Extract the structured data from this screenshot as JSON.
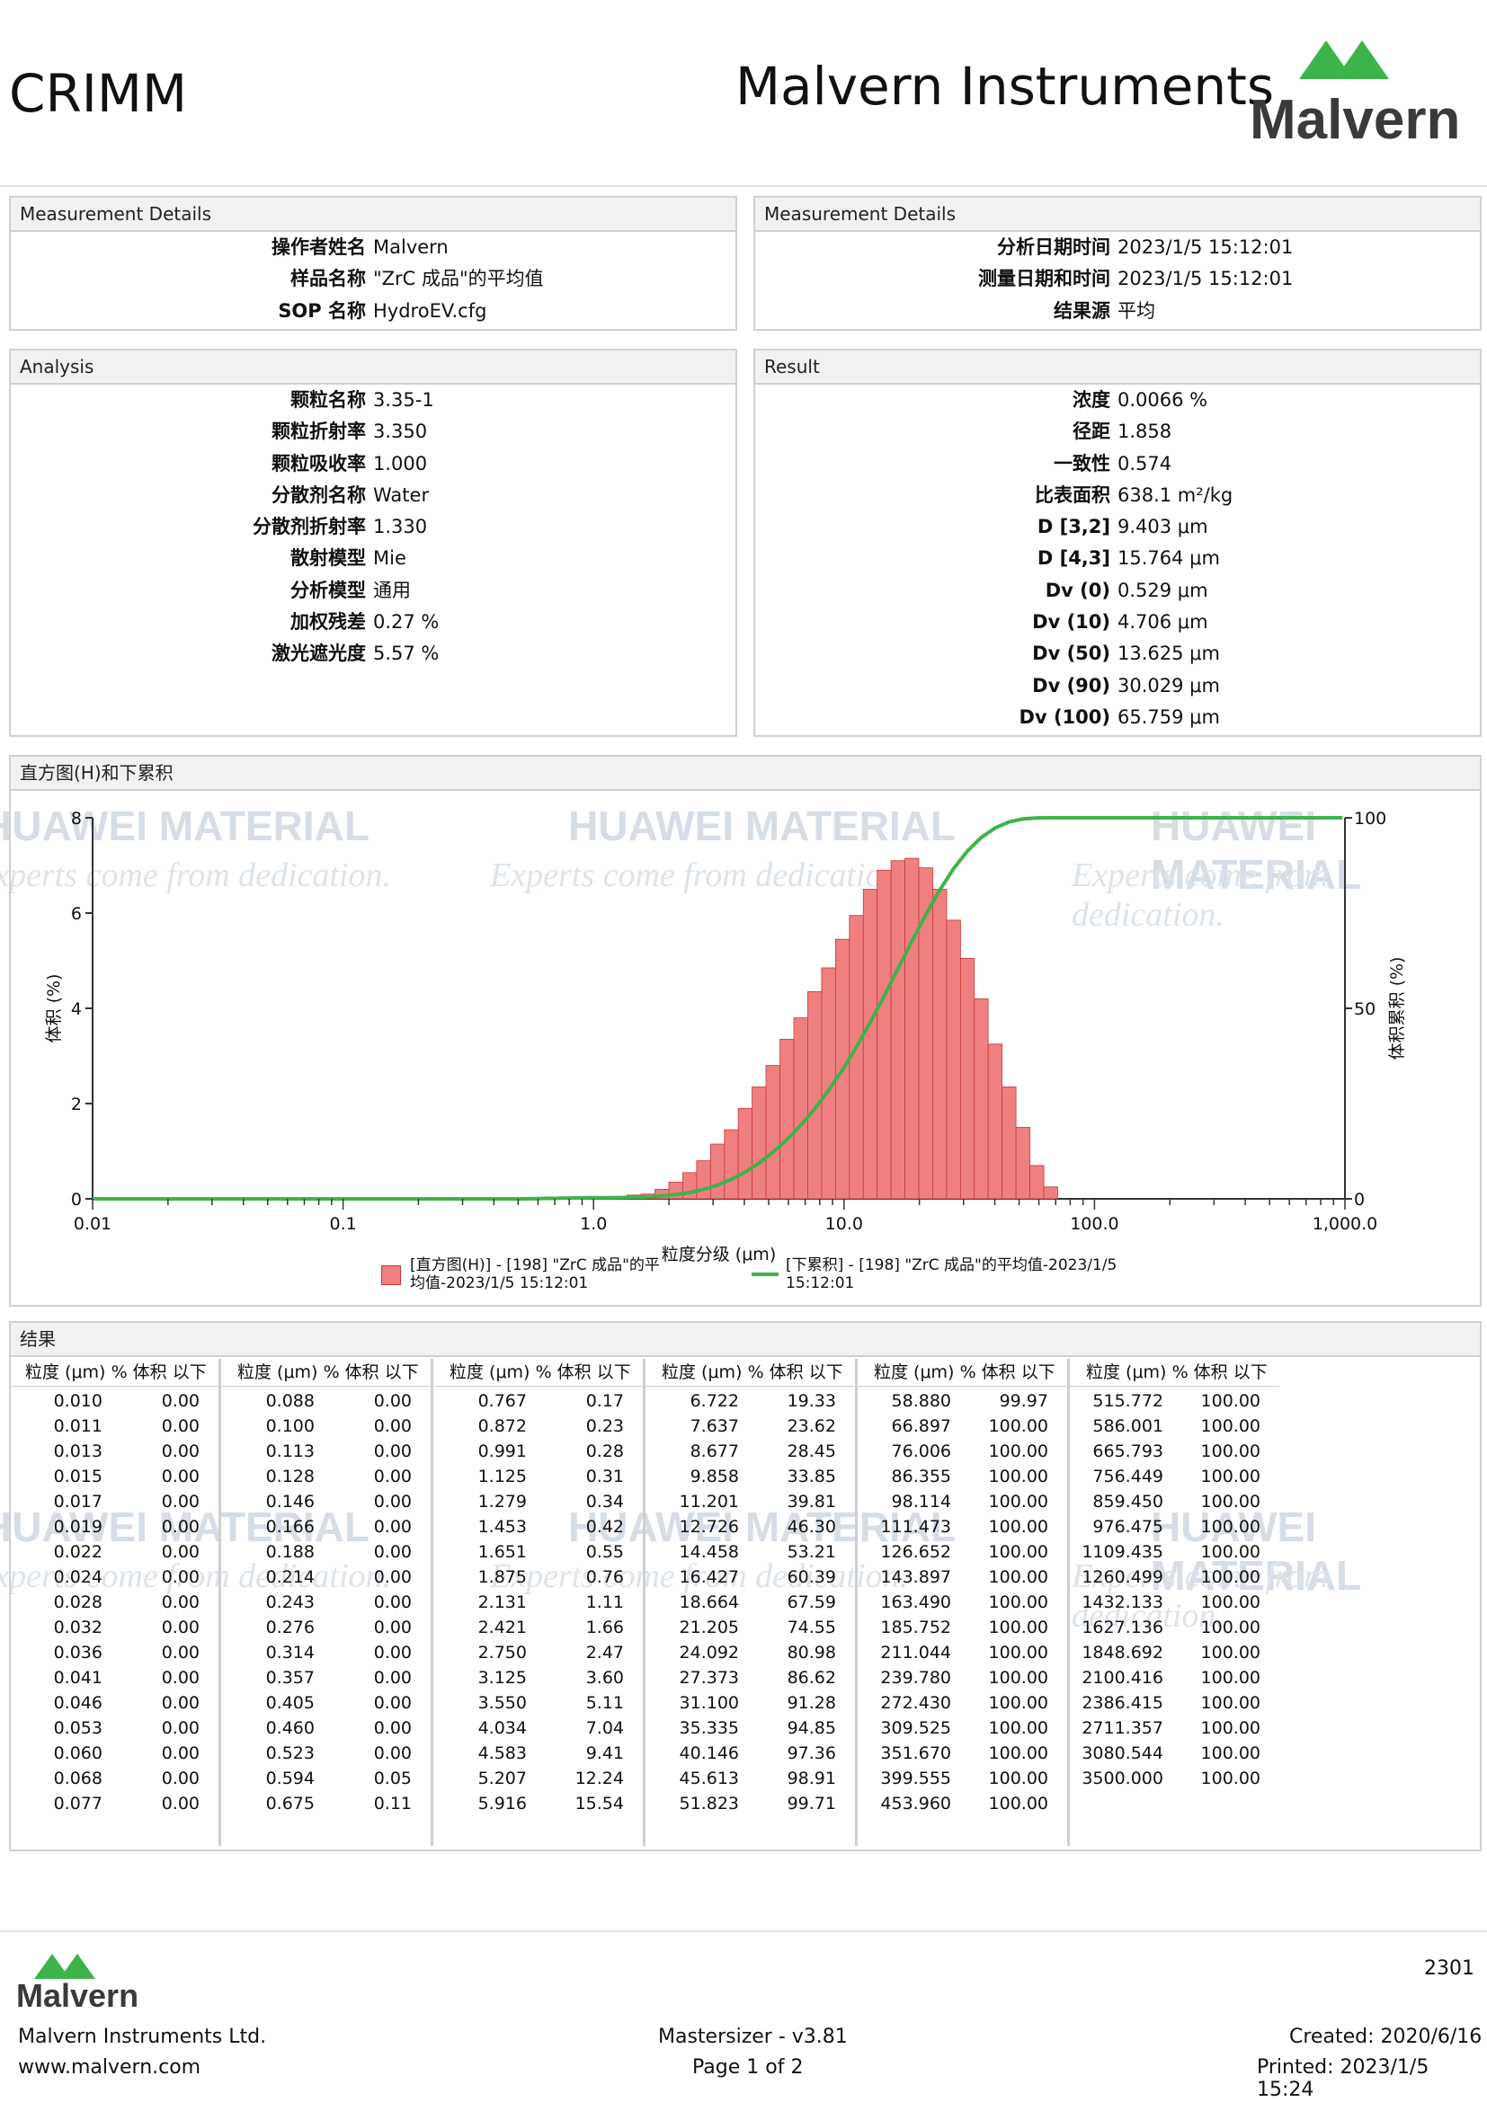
{
  "header": {
    "org": "CRIMM",
    "company": "Malvern Instruments",
    "logo_text": "Malvern"
  },
  "details_left": {
    "title": "Measurement Details",
    "rows": [
      {
        "k": "操作者姓名",
        "v": "Malvern"
      },
      {
        "k": "样品名称",
        "v": "\"ZrC 成品\"的平均值"
      },
      {
        "k": "SOP 名称",
        "v": "HydroEV.cfg"
      }
    ]
  },
  "details_right": {
    "title": "Measurement Details",
    "rows": [
      {
        "k": "分析日期时间",
        "v": "2023/1/5 15:12:01"
      },
      {
        "k": "测量日期和时间",
        "v": "2023/1/5 15:12:01"
      },
      {
        "k": "结果源",
        "v": "平均"
      }
    ]
  },
  "analysis": {
    "title": "Analysis",
    "rows": [
      {
        "k": "颗粒名称",
        "v": "3.35-1"
      },
      {
        "k": "颗粒折射率",
        "v": "3.350"
      },
      {
        "k": "颗粒吸收率",
        "v": "1.000"
      },
      {
        "k": "分散剂名称",
        "v": "Water"
      },
      {
        "k": "分散剂折射率",
        "v": "1.330"
      },
      {
        "k": "散射模型",
        "v": "Mie"
      },
      {
        "k": "分析模型",
        "v": "通用"
      },
      {
        "k": "加权残差",
        "v": "0.27 %"
      },
      {
        "k": "激光遮光度",
        "v": "5.57 %"
      }
    ]
  },
  "result": {
    "title": "Result",
    "rows": [
      {
        "k": "浓度",
        "v": "0.0066 %"
      },
      {
        "k": "径距",
        "v": "1.858"
      },
      {
        "k": "一致性",
        "v": "0.574"
      },
      {
        "k": "比表面积",
        "v": "638.1 m²/kg"
      },
      {
        "k": "D [3,2]",
        "v": "9.403 μm"
      },
      {
        "k": "D [4,3]",
        "v": "15.764 μm"
      },
      {
        "k": "Dv (0)",
        "v": "0.529 μm"
      },
      {
        "k": "Dv (10)",
        "v": "4.706 μm"
      },
      {
        "k": "Dv (50)",
        "v": "13.625 μm"
      },
      {
        "k": "Dv (90)",
        "v": "30.029 μm"
      },
      {
        "k": "Dv (100)",
        "v": "65.759 μm"
      }
    ]
  },
  "watermark": {
    "line1": "HUAWEI MATERIAL",
    "line2": "Experts come from dedication."
  },
  "chart_data": {
    "type": "bar",
    "title": "直方图(H)和下累积",
    "xlabel": "粒度分级 (μm)",
    "ylabel": "体积 (%)",
    "y2label": "体积累积 (%)",
    "xscale": "log",
    "xlim": [
      0.01,
      1000
    ],
    "ylim": [
      0,
      8
    ],
    "y2lim": [
      0,
      100
    ],
    "xticks": [
      "0.01",
      "0.1",
      "1.0",
      "10.0",
      "100.0",
      "1,000.0"
    ],
    "yticks": [
      "0",
      "2",
      "4",
      "6",
      "8"
    ],
    "y2ticks": [
      "0",
      "50",
      "100"
    ],
    "colors": {
      "hist": "#f08080",
      "hist_edge": "#c43a3a",
      "cum": "#3cb44b"
    },
    "series": [
      {
        "name": "[直方图(H)] - [198] \"ZrC 成品\"的平均值-2023/1/5 15:12:01",
        "type": "bar",
        "x": [
          0.525,
          0.6,
          0.68,
          0.77,
          0.87,
          0.99,
          1.125,
          1.28,
          1.45,
          1.65,
          1.875,
          2.13,
          2.42,
          2.75,
          3.125,
          3.55,
          4.03,
          4.58,
          5.2,
          5.92,
          6.72,
          7.64,
          8.68,
          9.86,
          11.2,
          12.73,
          14.46,
          16.43,
          18.66,
          21.2,
          24.1,
          27.4,
          31.1,
          35.3,
          40.1,
          45.6,
          51.8,
          58.9,
          66.9
        ],
        "values": [
          0.02,
          0.03,
          0.04,
          0.03,
          0.04,
          0.05,
          0.03,
          0.03,
          0.08,
          0.1,
          0.2,
          0.35,
          0.55,
          0.8,
          1.15,
          1.45,
          1.9,
          2.35,
          2.8,
          3.35,
          3.8,
          4.35,
          4.85,
          5.45,
          5.95,
          6.5,
          6.9,
          7.1,
          7.15,
          6.95,
          6.5,
          5.85,
          5.05,
          4.2,
          3.25,
          2.35,
          1.5,
          0.7,
          0.25
        ]
      },
      {
        "name": "[下累积] - [198] \"ZrC 成品\"的平均值-2023/1/5 15:12:01",
        "type": "line"
      }
    ]
  },
  "table": {
    "title": "结果",
    "h1": "粒度 (μm)",
    "h2": "% 体积 以下",
    "columns": [
      [
        [
          "0.010",
          "0.00"
        ],
        [
          "0.011",
          "0.00"
        ],
        [
          "0.013",
          "0.00"
        ],
        [
          "0.015",
          "0.00"
        ],
        [
          "0.017",
          "0.00"
        ],
        [
          "0.019",
          "0.00"
        ],
        [
          "0.022",
          "0.00"
        ],
        [
          "0.024",
          "0.00"
        ],
        [
          "0.028",
          "0.00"
        ],
        [
          "0.032",
          "0.00"
        ],
        [
          "0.036",
          "0.00"
        ],
        [
          "0.041",
          "0.00"
        ],
        [
          "0.046",
          "0.00"
        ],
        [
          "0.053",
          "0.00"
        ],
        [
          "0.060",
          "0.00"
        ],
        [
          "0.068",
          "0.00"
        ],
        [
          "0.077",
          "0.00"
        ]
      ],
      [
        [
          "0.088",
          "0.00"
        ],
        [
          "0.100",
          "0.00"
        ],
        [
          "0.113",
          "0.00"
        ],
        [
          "0.128",
          "0.00"
        ],
        [
          "0.146",
          "0.00"
        ],
        [
          "0.166",
          "0.00"
        ],
        [
          "0.188",
          "0.00"
        ],
        [
          "0.214",
          "0.00"
        ],
        [
          "0.243",
          "0.00"
        ],
        [
          "0.276",
          "0.00"
        ],
        [
          "0.314",
          "0.00"
        ],
        [
          "0.357",
          "0.00"
        ],
        [
          "0.405",
          "0.00"
        ],
        [
          "0.460",
          "0.00"
        ],
        [
          "0.523",
          "0.00"
        ],
        [
          "0.594",
          "0.05"
        ],
        [
          "0.675",
          "0.11"
        ]
      ],
      [
        [
          "0.767",
          "0.17"
        ],
        [
          "0.872",
          "0.23"
        ],
        [
          "0.991",
          "0.28"
        ],
        [
          "1.125",
          "0.31"
        ],
        [
          "1.279",
          "0.34"
        ],
        [
          "1.453",
          "0.42"
        ],
        [
          "1.651",
          "0.55"
        ],
        [
          "1.875",
          "0.76"
        ],
        [
          "2.131",
          "1.11"
        ],
        [
          "2.421",
          "1.66"
        ],
        [
          "2.750",
          "2.47"
        ],
        [
          "3.125",
          "3.60"
        ],
        [
          "3.550",
          "5.11"
        ],
        [
          "4.034",
          "7.04"
        ],
        [
          "4.583",
          "9.41"
        ],
        [
          "5.207",
          "12.24"
        ],
        [
          "5.916",
          "15.54"
        ]
      ],
      [
        [
          "6.722",
          "19.33"
        ],
        [
          "7.637",
          "23.62"
        ],
        [
          "8.677",
          "28.45"
        ],
        [
          "9.858",
          "33.85"
        ],
        [
          "11.201",
          "39.81"
        ],
        [
          "12.726",
          "46.30"
        ],
        [
          "14.458",
          "53.21"
        ],
        [
          "16.427",
          "60.39"
        ],
        [
          "18.664",
          "67.59"
        ],
        [
          "21.205",
          "74.55"
        ],
        [
          "24.092",
          "80.98"
        ],
        [
          "27.373",
          "86.62"
        ],
        [
          "31.100",
          "91.28"
        ],
        [
          "35.335",
          "94.85"
        ],
        [
          "40.146",
          "97.36"
        ],
        [
          "45.613",
          "98.91"
        ],
        [
          "51.823",
          "99.71"
        ]
      ],
      [
        [
          "58.880",
          "99.97"
        ],
        [
          "66.897",
          "100.00"
        ],
        [
          "76.006",
          "100.00"
        ],
        [
          "86.355",
          "100.00"
        ],
        [
          "98.114",
          "100.00"
        ],
        [
          "111.473",
          "100.00"
        ],
        [
          "126.652",
          "100.00"
        ],
        [
          "143.897",
          "100.00"
        ],
        [
          "163.490",
          "100.00"
        ],
        [
          "185.752",
          "100.00"
        ],
        [
          "211.044",
          "100.00"
        ],
        [
          "239.780",
          "100.00"
        ],
        [
          "272.430",
          "100.00"
        ],
        [
          "309.525",
          "100.00"
        ],
        [
          "351.670",
          "100.00"
        ],
        [
          "399.555",
          "100.00"
        ],
        [
          "453.960",
          "100.00"
        ]
      ],
      [
        [
          "515.772",
          "100.00"
        ],
        [
          "586.001",
          "100.00"
        ],
        [
          "665.793",
          "100.00"
        ],
        [
          "756.449",
          "100.00"
        ],
        [
          "859.450",
          "100.00"
        ],
        [
          "976.475",
          "100.00"
        ],
        [
          "1109.435",
          "100.00"
        ],
        [
          "1260.499",
          "100.00"
        ],
        [
          "1432.133",
          "100.00"
        ],
        [
          "1627.136",
          "100.00"
        ],
        [
          "1848.692",
          "100.00"
        ],
        [
          "2100.416",
          "100.00"
        ],
        [
          "2386.415",
          "100.00"
        ],
        [
          "2711.357",
          "100.00"
        ],
        [
          "3080.544",
          "100.00"
        ],
        [
          "3500.000",
          "100.00"
        ]
      ]
    ]
  },
  "footer": {
    "code": "2301",
    "logo_text": "Malvern",
    "company": "Malvern Instruments Ltd.",
    "web": "www.malvern.com",
    "software": "Mastersizer - v3.81",
    "page": "Page 1 of 2",
    "created": "Created:  2020/6/16",
    "printed": "Printed:  2023/1/5 15:24"
  }
}
